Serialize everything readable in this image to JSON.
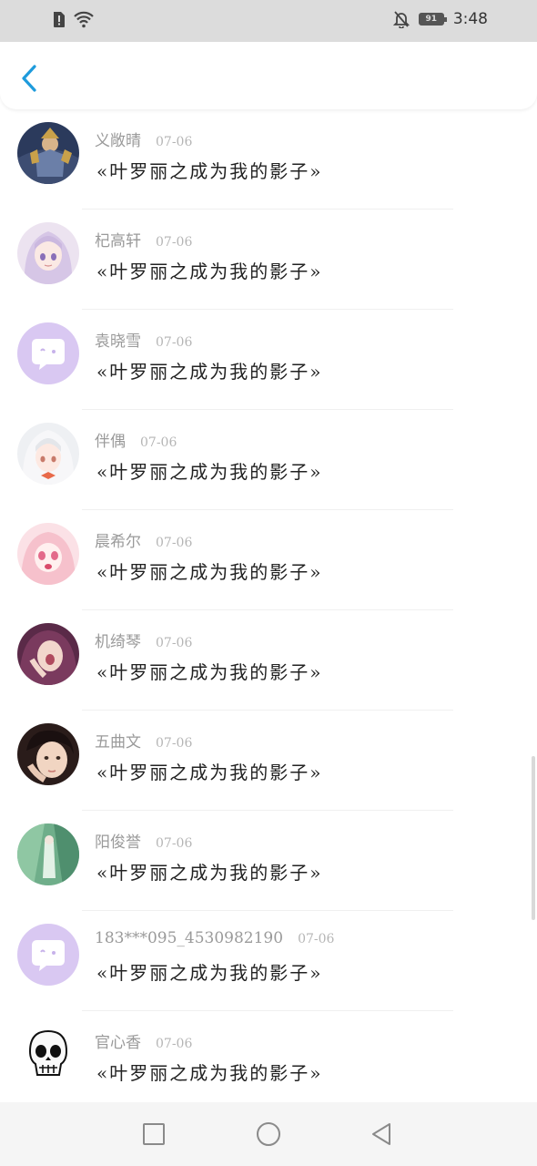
{
  "status_bar": {
    "battery_level": "91",
    "time": "3:48"
  },
  "header": {
    "back_icon": "chevron-left-icon",
    "accent_color": "#1e9bdc"
  },
  "messages": [
    {
      "name": "义敞晴",
      "date": "07-06",
      "text": "«叶罗丽之成为我的影子»",
      "avatar": "armored-hero-avatar"
    },
    {
      "name": "杞高轩",
      "date": "07-06",
      "text": "«叶罗丽之成为我的影子»",
      "avatar": "anime-girl-lilac-hair-avatar"
    },
    {
      "name": "袁晓雪",
      "date": "07-06",
      "text": "«叶罗丽之成为我的影子»",
      "avatar": "default-chat-bubble-avatar"
    },
    {
      "name": "伴偶",
      "date": "07-06",
      "text": "«叶罗丽之成为我的影子»",
      "avatar": "anime-girl-white-hair-avatar"
    },
    {
      "name": "晨希尔",
      "date": "07-06",
      "text": "«叶罗丽之成为我的影子»",
      "avatar": "anime-girl-pink-avatar"
    },
    {
      "name": "机绮琴",
      "date": "07-06",
      "text": "«叶罗丽之成为我的影子»",
      "avatar": "anime-girl-purple-avatar"
    },
    {
      "name": "五曲文",
      "date": "07-06",
      "text": "«叶罗丽之成为我的影子»",
      "avatar": "photo-boy-avatar"
    },
    {
      "name": "阳俊誉",
      "date": "07-06",
      "text": "«叶罗丽之成为我的影子»",
      "avatar": "green-fantasy-avatar"
    },
    {
      "name": "183***095_4530982190",
      "date": "07-06",
      "text": "«叶罗丽之成为我的影子»",
      "avatar": "default-chat-bubble-avatar"
    },
    {
      "name": "官心香",
      "date": "07-06",
      "text": "«叶罗丽之成为我的影子»",
      "avatar": "skull-sketch-avatar"
    }
  ],
  "nav_bar": {
    "recent_icon": "square-recent-apps-icon",
    "home_icon": "circle-home-icon",
    "back_icon": "triangle-back-icon"
  }
}
